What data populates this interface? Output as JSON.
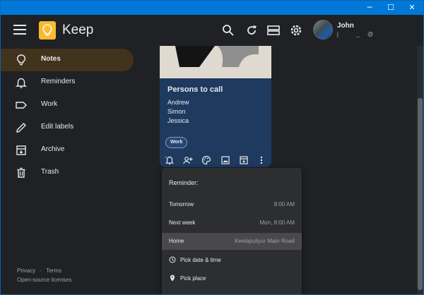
{
  "window": {
    "controls": {
      "minimize": "─",
      "maximize": "☐",
      "close": "✕"
    }
  },
  "app": {
    "title": "Keep",
    "icons": [
      "menu-icon",
      "search-icon",
      "refresh-icon",
      "list-view-icon",
      "settings-icon"
    ]
  },
  "user": {
    "name": "John",
    "email": "j            _     @            "
  },
  "sidebar": {
    "items": [
      {
        "label": "Notes",
        "icon": "lightbulb-icon",
        "active": true
      },
      {
        "label": "Reminders",
        "icon": "bell-icon"
      },
      {
        "label": "Work",
        "icon": "label-icon"
      },
      {
        "label": "Edit labels",
        "icon": "pencil-icon"
      },
      {
        "label": "Archive",
        "icon": "archive-icon"
      },
      {
        "label": "Trash",
        "icon": "trash-icon"
      }
    ],
    "footer": {
      "privacy": "Privacy",
      "separator": "·",
      "terms": "Terms",
      "licenses": "Open-source licenses"
    }
  },
  "note": {
    "title": "Persons to call",
    "lines": [
      "Andrew",
      "Simon",
      "Jessica"
    ],
    "label": "Work",
    "toolbar": [
      "remind-me-icon",
      "collaborator-icon",
      "palette-icon",
      "image-icon",
      "archive-icon",
      "more-icon"
    ],
    "background_color": "#1e3a5f"
  },
  "reminder_menu": {
    "header": "Reminder:",
    "items": [
      {
        "label": "Tomorrow",
        "value": "8:00 AM"
      },
      {
        "label": "Next week",
        "value": "Mon, 8:00 AM"
      },
      {
        "label": "Home",
        "value": "Keelapuliyur Main Road",
        "highlighted": true
      },
      {
        "label": "Pick date & time",
        "icon": "clock-icon"
      },
      {
        "label": "Pick place",
        "icon": "place-icon"
      }
    ]
  },
  "colors": {
    "titlebar": "#0078d7",
    "background": "#202124",
    "active_nav": "#41331c",
    "logo": "#f9bb2d"
  }
}
